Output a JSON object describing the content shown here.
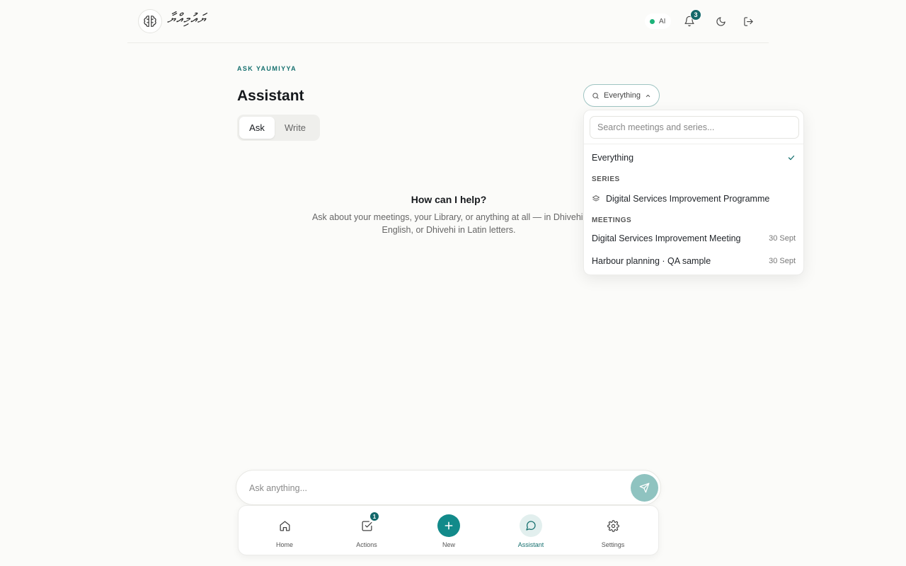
{
  "header": {
    "brand_text": "ޔައުމިއްޔާ",
    "ai_status_label": "AI",
    "notification_count": "3"
  },
  "main": {
    "eyebrow": "ASK YAUMIYYA",
    "title": "Assistant",
    "modes": [
      {
        "label": "Ask",
        "active": true
      },
      {
        "label": "Write",
        "active": false
      }
    ],
    "scope_selected": "Everything",
    "empty_state": {
      "title": "How can I help?",
      "subtitle": "Ask about your meetings, your Library, or anything at all — in Dhivehi, English, or Dhivehi in Latin letters."
    }
  },
  "scope_dropdown": {
    "search_placeholder": "Search meetings and series...",
    "everything_label": "Everything",
    "series_heading": "SERIES",
    "series": [
      {
        "label": "Digital Services Improvement Programme"
      }
    ],
    "meetings_heading": "MEETINGS",
    "meetings": [
      {
        "label": "Digital Services Improvement Meeting",
        "date": "30 Sept"
      },
      {
        "label": "Harbour planning · QA sample",
        "date": "30 Sept"
      }
    ]
  },
  "composer": {
    "placeholder": "Ask anything..."
  },
  "bottom_nav": {
    "items": [
      {
        "label": "Home"
      },
      {
        "label": "Actions",
        "badge": "1"
      },
      {
        "label": "New"
      },
      {
        "label": "Assistant"
      },
      {
        "label": "Settings"
      }
    ]
  },
  "colors": {
    "accent": "#16706f",
    "new_button": "#128a8a",
    "send_button": "#8fc3c0",
    "ai_dot": "#1db37a"
  }
}
